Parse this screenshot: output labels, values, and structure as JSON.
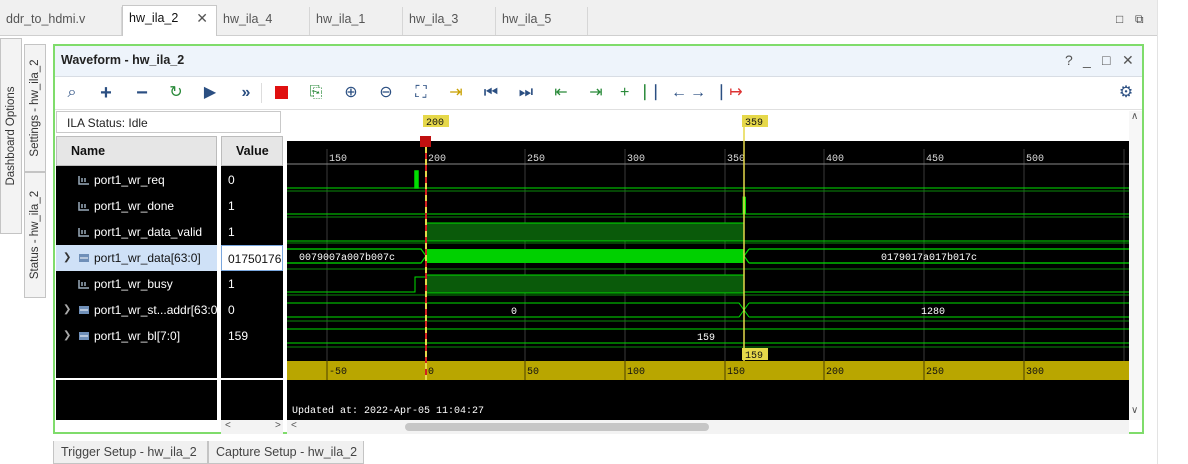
{
  "editor_tabs": [
    {
      "label": "ddr_to_hdmi.v",
      "active": false
    },
    {
      "label": "hw_ila_2",
      "active": true
    },
    {
      "label": "hw_ila_4",
      "active": false
    },
    {
      "label": "hw_ila_1",
      "active": false
    },
    {
      "label": "hw_ila_3",
      "active": false
    },
    {
      "label": "hw_ila_5",
      "active": false
    }
  ],
  "side_tabs": {
    "dashboard": "Dashboard Options",
    "settings": "Settings - hw_ila_2",
    "status": "Status - hw_ila_2"
  },
  "panel": {
    "title": "Waveform - hw_ila_2",
    "help": "?",
    "minimize": "_",
    "maximize": "□",
    "close": "✕"
  },
  "toolbar_icons": [
    "search-icon",
    "add-icon",
    "remove-icon",
    "refresh-icon",
    "run-icon",
    "run-immediate-icon",
    "stop-icon",
    "export-icon",
    "zoom-in-icon",
    "zoom-out-icon",
    "zoom-fit-icon",
    "go-to-cursor-icon",
    "go-to-start-icon",
    "go-to-end-icon",
    "previous-transition-icon",
    "next-transition-icon",
    "add-marker-icon",
    "previous-marker-icon",
    "next-marker-icon",
    "swap-cursors-icon",
    "settings-gear-icon"
  ],
  "ila_status": "ILA Status: Idle",
  "columns": {
    "name": "Name",
    "value": "Value"
  },
  "signals": [
    {
      "name": "port1_wr_req",
      "value": "0",
      "type": "bit",
      "expandable": false
    },
    {
      "name": "port1_wr_done",
      "value": "1",
      "type": "bit",
      "expandable": false
    },
    {
      "name": "port1_wr_data_valid",
      "value": "1",
      "type": "bit",
      "expandable": false
    },
    {
      "name": "port1_wr_data[63:0]",
      "value": "01750176",
      "type": "bus",
      "expandable": true,
      "selected": true
    },
    {
      "name": "port1_wr_busy",
      "value": "1",
      "type": "bit",
      "expandable": false
    },
    {
      "name": "port1_wr_st...addr[63:0]",
      "value": "0",
      "type": "bus",
      "expandable": true
    },
    {
      "name": "port1_wr_bl[7:0]",
      "value": "159",
      "type": "bus",
      "expandable": true
    }
  ],
  "waveform": {
    "top_ruler_labels": [
      "150",
      "200",
      "250",
      "300",
      "350",
      "400",
      "450",
      "500"
    ],
    "bottom_ruler_labels": [
      "-50",
      "0",
      "50",
      "100",
      "150",
      "200",
      "250",
      "300"
    ],
    "marker_left": "200",
    "marker_right": "359",
    "bottom_marker": "159",
    "bus_data_left": "0079007a007b007c",
    "bus_data_right": "0179017a017b017c",
    "addr_left": "0",
    "addr_right": "1280",
    "bl_value": "159",
    "updated_at": "Updated at: 2022-Apr-05 11:04:27",
    "colors": {
      "trace": "#00ff00",
      "background": "#000000",
      "marker": "#e6d84a",
      "trigger": "#d42020",
      "ruler": "#b9a600"
    }
  },
  "bottom_tabs": [
    "Trigger Setup - hw_ila_2",
    "Capture Setup - hw_ila_2"
  ]
}
